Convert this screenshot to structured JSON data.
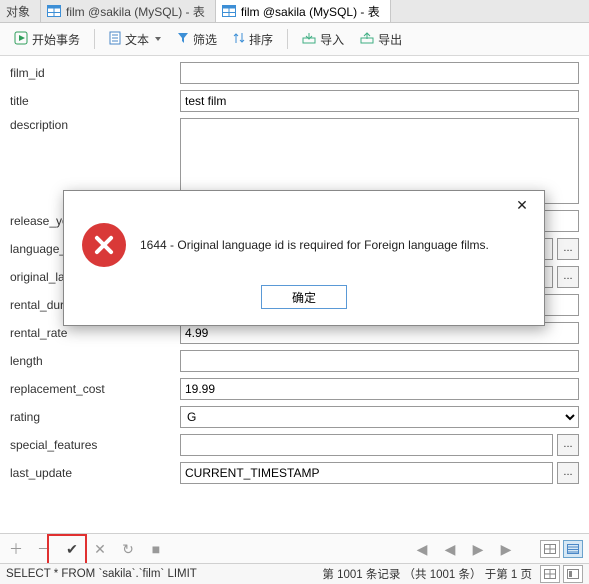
{
  "tabs": {
    "items": [
      {
        "label": "对象"
      },
      {
        "label": "film @sakila (MySQL) - 表"
      },
      {
        "label": "film @sakila (MySQL) - 表"
      }
    ],
    "active_index": 2
  },
  "toolbar": {
    "begin_tx": "开始事务",
    "text": "文本",
    "filter": "筛选",
    "sort": "排序",
    "import": "导入",
    "export": "导出"
  },
  "form": {
    "film_id": {
      "label": "film_id",
      "value": ""
    },
    "title": {
      "label": "title",
      "value": "test film"
    },
    "description": {
      "label": "description",
      "value": ""
    },
    "release_year": {
      "label": "release_year",
      "value": ""
    },
    "language_id": {
      "label": "language_id",
      "value": ""
    },
    "original_language_id": {
      "label": "original_language_id",
      "value": ""
    },
    "rental_duration": {
      "label": "rental_duration",
      "value": ""
    },
    "rental_rate": {
      "label": "rental_rate",
      "value": "4.99"
    },
    "length": {
      "label": "length",
      "value": ""
    },
    "replacement_cost": {
      "label": "replacement_cost",
      "value": "19.99"
    },
    "rating": {
      "label": "rating",
      "value": "G"
    },
    "special_features": {
      "label": "special_features",
      "value": ""
    },
    "last_update": {
      "label": "last_update",
      "value": "CURRENT_TIMESTAMP"
    },
    "more_button": "..."
  },
  "dialog": {
    "message": "1644 - Original language id is required for Foreign language films.",
    "ok": "确定"
  },
  "bottom": {
    "plus": "＋",
    "minus": "－",
    "check": "✔",
    "x": "✕",
    "refresh": "↻",
    "stop": "■",
    "prev": "◀",
    "next": "▶",
    "prev2": "◀",
    "next2": "▶"
  },
  "status": {
    "sql": "SELECT * FROM `sakila`.`film` LIMIT",
    "record_info": "第 1001 条记录 （共 1001 条） 于第 1 页"
  }
}
